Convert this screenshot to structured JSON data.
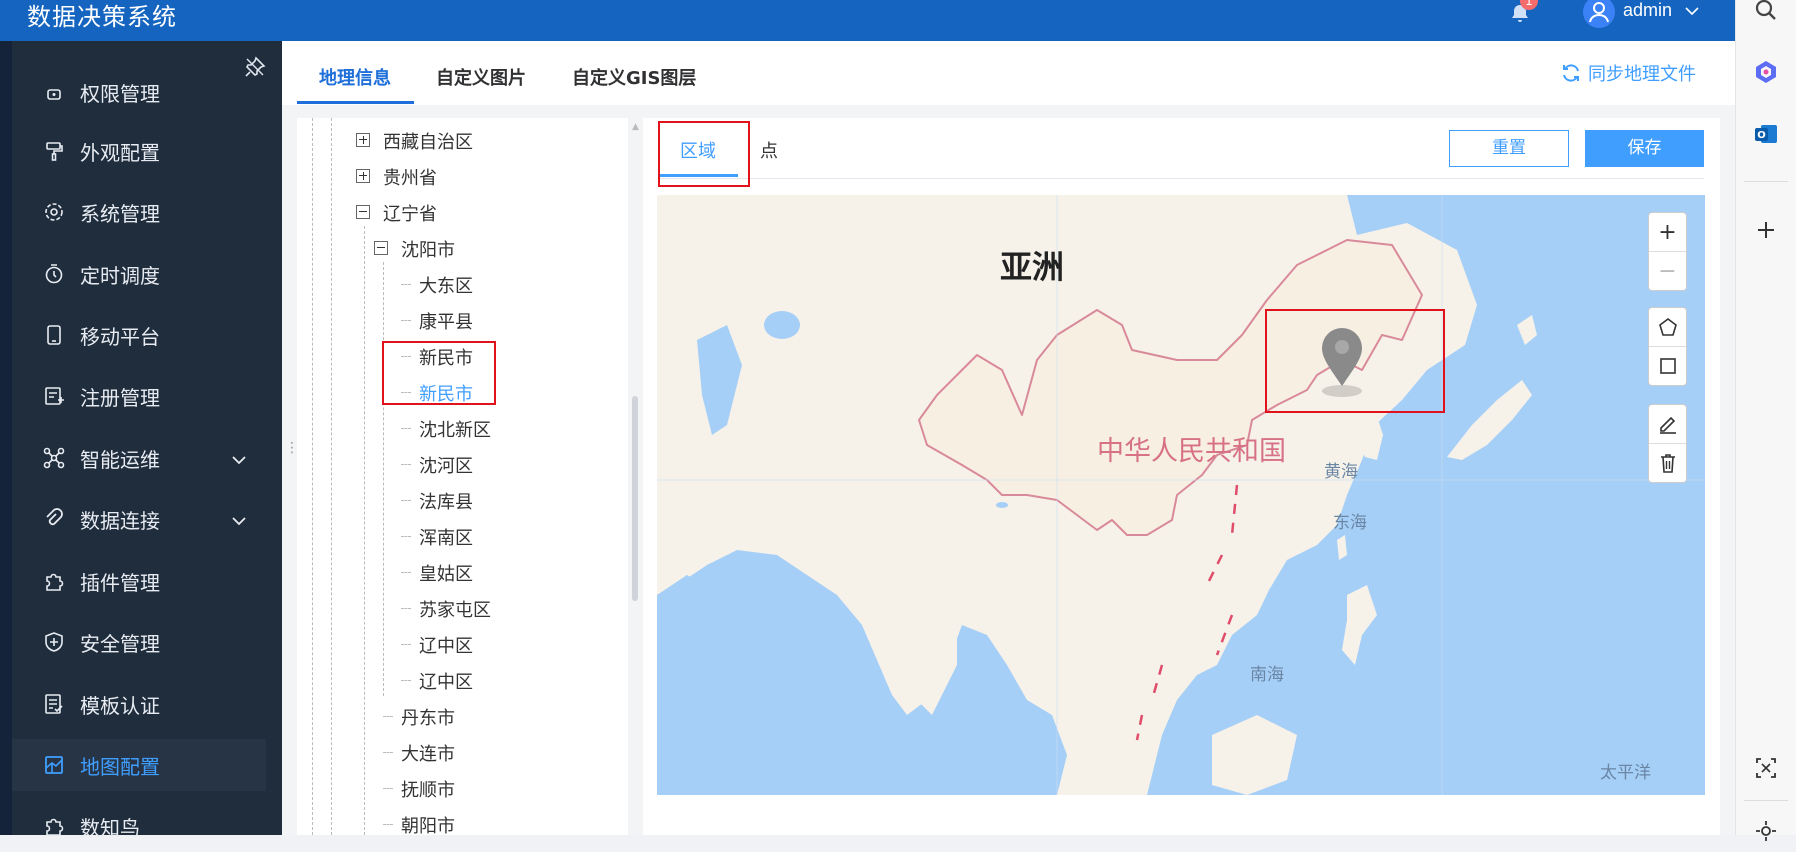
{
  "app": {
    "title": "数据决策系统"
  },
  "header": {
    "notification_count": "1",
    "username": "admin"
  },
  "colors": {
    "primary": "#409eff",
    "header_bg": "#1565c0",
    "sidebar_bg": "#1f2d3d",
    "highlight": "#e0121b"
  },
  "sidebar": {
    "items": [
      {
        "label": "权限管理",
        "icon": "shield-lock-icon"
      },
      {
        "label": "外观配置",
        "icon": "paint-roller-icon"
      },
      {
        "label": "系统管理",
        "icon": "gear-icon"
      },
      {
        "label": "定时调度",
        "icon": "timer-icon"
      },
      {
        "label": "移动平台",
        "icon": "mobile-icon"
      },
      {
        "label": "注册管理",
        "icon": "register-icon"
      },
      {
        "label": "智能运维",
        "icon": "network-icon",
        "expandable": true
      },
      {
        "label": "数据连接",
        "icon": "link-icon",
        "expandable": true
      },
      {
        "label": "插件管理",
        "icon": "puzzle-icon"
      },
      {
        "label": "安全管理",
        "icon": "shield-plus-icon"
      },
      {
        "label": "模板认证",
        "icon": "document-check-icon"
      },
      {
        "label": "地图配置",
        "icon": "map-icon",
        "active": true
      },
      {
        "label": "数知鸟",
        "icon": "bird-icon"
      }
    ]
  },
  "tabs": [
    {
      "label": "地理信息",
      "active": true
    },
    {
      "label": "自定义图片"
    },
    {
      "label": "自定义GIS图层"
    }
  ],
  "sync_label": "同步地理文件",
  "tree": {
    "nodes": [
      {
        "label": "西藏自治区",
        "expander": "plus"
      },
      {
        "label": "贵州省",
        "expander": "plus"
      },
      {
        "label": "辽宁省",
        "expander": "minus"
      },
      {
        "label": "沈阳市",
        "expander": "minus"
      },
      {
        "label": "大东区"
      },
      {
        "label": "康平县"
      },
      {
        "label": "新民市"
      },
      {
        "label": "新民市",
        "selected": true
      },
      {
        "label": "沈北新区"
      },
      {
        "label": "沈河区"
      },
      {
        "label": "法库县"
      },
      {
        "label": "浑南区"
      },
      {
        "label": "皇姑区"
      },
      {
        "label": "苏家屯区"
      },
      {
        "label": "辽中区"
      },
      {
        "label": "辽中区"
      },
      {
        "label": "丹东市"
      },
      {
        "label": "大连市"
      },
      {
        "label": "抚顺市"
      },
      {
        "label": "朝阳市"
      }
    ]
  },
  "editor": {
    "sub_tabs": [
      {
        "label": "区域",
        "active": true
      },
      {
        "label": "点"
      }
    ],
    "reset_label": "重置",
    "save_label": "保存"
  },
  "map": {
    "labels": {
      "continent": "亚洲",
      "country": "中华人民共和国",
      "yellow_sea": "黄海",
      "east_sea": "东海",
      "south_sea": "南海",
      "pacific": "太平洋"
    },
    "controls": {
      "zoom_in": "+",
      "zoom_out": "−"
    }
  }
}
